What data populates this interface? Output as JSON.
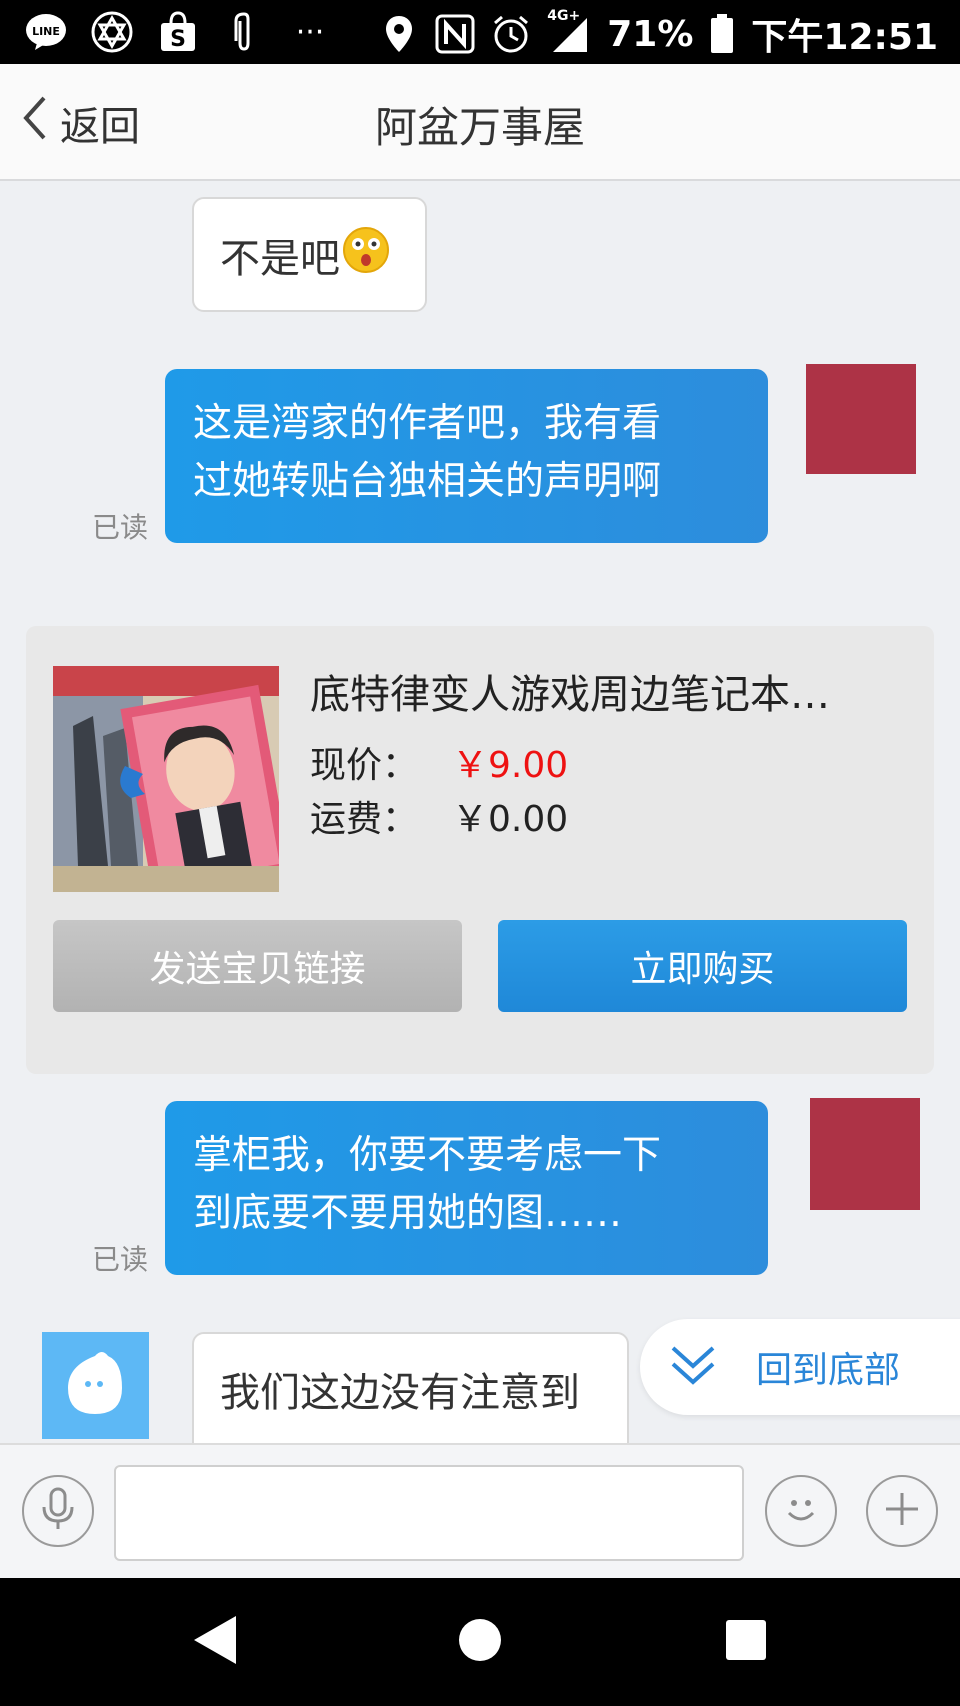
{
  "status_bar": {
    "dots": "···",
    "network": "4G+",
    "battery": "71%",
    "time": "下午12:51"
  },
  "header": {
    "back_label": "返回",
    "title": "阿盆万事屋"
  },
  "messages": {
    "m1": "不是吧",
    "m2_line1": "这是湾家的作者吧，我有看",
    "m2_line2": "过她转贴台独相关的声明啊",
    "m2_status": "已读",
    "m3_line1": "掌柜我，你要不要考虑一下",
    "m3_line2": "到底要不要用她的图……",
    "m3_status": "已读",
    "m4": "我们这边没有注意到"
  },
  "product": {
    "title": "底特律变人游戏周边笔记本…",
    "price_label": "现价：",
    "price": "￥9.00",
    "shipping_label": "运费：",
    "shipping": "￥0.00",
    "send_link_button": "发送宝贝链接",
    "buy_button": "立即购买"
  },
  "back_to_bottom": "回到底部",
  "colors": {
    "accent_blue": "#1f9ae8",
    "price_red": "#ee1111",
    "avatar_red": "#ad3346",
    "bot_blue": "#5db8f5"
  },
  "icons": {
    "back": "chevron-left-icon",
    "mic": "microphone-icon",
    "emoji": "smiley-icon",
    "plus": "plus-icon",
    "to_bottom": "double-chevron-down-icon"
  }
}
